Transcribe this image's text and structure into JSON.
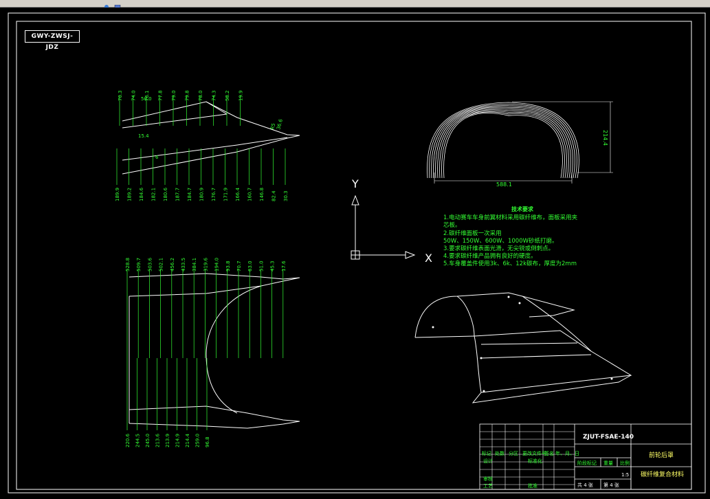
{
  "drawing": {
    "code_tag": "GWY-ZWSJ-JDZ",
    "axis_x": "X",
    "axis_y": "Y",
    "tech_req": {
      "heading": "技术要求",
      "lines": [
        "1.电动赛车车身前翼材料采用碳纤维布，面板采用夹",
        "芯板。",
        "2.碳纤维面板一次采用",
        "50W、150W、600W、1000W砂纸打磨。",
        "3.要求碳纤维表面光滑，无尖锐或倒刺点。",
        "4.要求碳纤维产品拥有良好的硬度。",
        "5.车身覆盖件使用3k、6k、12k碳布，厚度为2mm"
      ]
    },
    "front_view": {
      "width_label": "588.1",
      "height_label": "214.4"
    },
    "top_profile": {
      "top_labels": [
        "70.3",
        "74.0",
        "76.1",
        "77.8",
        "79.0",
        "79.8",
        "78.0",
        "74.3",
        "58.2",
        "19.9"
      ],
      "bottom_labels": [
        "189.9",
        "189.2",
        "184.6",
        "182.1",
        "180.6",
        "187.7",
        "184.7",
        "180.9",
        "176.7",
        "171.9",
        "166.4",
        "160.7",
        "146.8",
        "82.4",
        "30.3"
      ],
      "misc_labels": [
        "50.0",
        "15.4",
        "6",
        "R5",
        "36.6"
      ]
    },
    "plan_profile": {
      "top_labels": [
        "528.8",
        "509.7",
        "503.6",
        "502.1",
        "456.2",
        "433.5",
        "384.1",
        "319.6",
        "194.0",
        "93.8",
        "70.7",
        "63.0",
        "51.0",
        "45.3",
        "17.6"
      ],
      "bottom_labels": [
        "220.6",
        "244.5",
        "245.0",
        "213.6",
        "213.9",
        "214.9",
        "214.4",
        "259.0",
        "96.8"
      ]
    },
    "title_block": {
      "drawing_no": "ZJUT-FSAE-140",
      "part_name": "前轮后罩",
      "material": "碳纤维复合材料",
      "scale": "1:5",
      "header_cells": [
        "标记",
        "处数",
        "分区",
        "更改文件号",
        "签名",
        "年、月、日"
      ],
      "role_design": "设计",
      "role_std": "标准化",
      "role_check": "审核",
      "role_process": "工艺",
      "role_approve": "批准",
      "stage_mark": "阶段标记",
      "weight": "重量",
      "ratio": "比例",
      "sheets_total": "共 4 张",
      "sheet_no": "第 4 张"
    }
  }
}
